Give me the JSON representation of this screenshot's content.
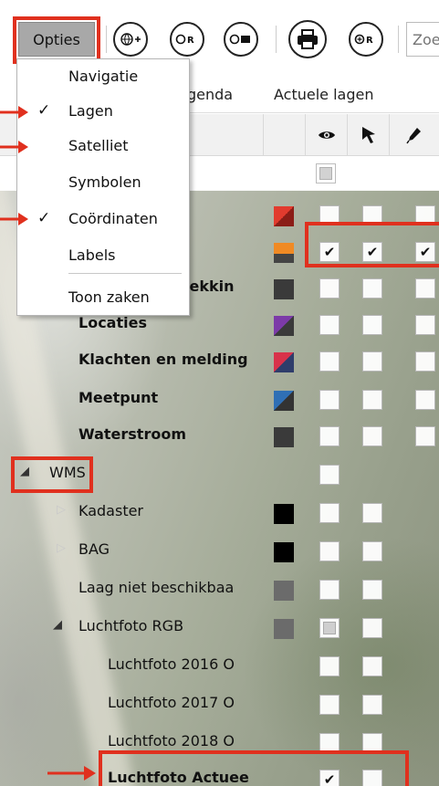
{
  "toolbar": {
    "opties_label": "Opties",
    "icons": [
      "globe-plus-icon",
      "zoom-area-icon",
      "zoom-layer-icon",
      "print-icon",
      "zoom-reset-icon"
    ],
    "search_placeholder": "Zoe"
  },
  "tabs": {
    "legenda": "genda",
    "actuele_lagen": "Actuele lagen"
  },
  "menu": {
    "items": [
      {
        "label": "Navigatie",
        "checked": false
      },
      {
        "label": "Lagen",
        "checked": true
      },
      {
        "label": "Satelliet",
        "checked": false
      },
      {
        "label": "Symbolen",
        "checked": false
      },
      {
        "label": "Coördinaten",
        "checked": true
      },
      {
        "label": "Labels",
        "checked": false
      },
      {
        "label": "Toon zaken",
        "checked": false
      }
    ],
    "check_glyph": "✓"
  },
  "layers": {
    "top_partial": "trekkin",
    "locaties": "Locaties",
    "klachten": "Klachten en melding",
    "meetpunt": "Meetpunt",
    "waterstroom": "Waterstroom",
    "wms": "WMS",
    "kadaster": "Kadaster",
    "bag": "BAG",
    "laag_niet": "Laag niet beschikbaa",
    "luchtfoto_rgb": "Luchtfoto RGB",
    "lf2016": "Luchtfoto 2016 O",
    "lf2017": "Luchtfoto 2017 O",
    "lf2018": "Luchtfoto 2018 O",
    "lf_actueel": "Luchtfoto Actuee"
  },
  "tick": "✔",
  "colors": {
    "highlight": "#e0301e",
    "header_bg": "#f1f1f1"
  }
}
